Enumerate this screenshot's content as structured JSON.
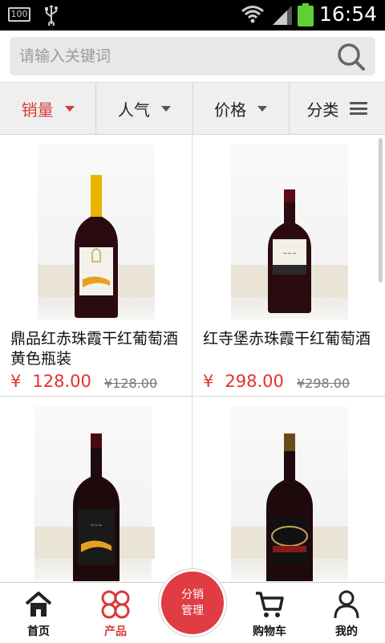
{
  "status_bar": {
    "battery_badge": "100",
    "time": "16:54"
  },
  "search": {
    "placeholder": "请输入关键词"
  },
  "filters": [
    {
      "label": "销量",
      "active": true
    },
    {
      "label": "人气",
      "active": false
    },
    {
      "label": "价格",
      "active": false
    },
    {
      "label": "分类",
      "active": false
    }
  ],
  "products": [
    {
      "name": "鼎品红赤珠霞干红葡萄酒黄色瓶装",
      "currency": "¥",
      "price": "128.00",
      "old_price": "¥128.00",
      "capsule_color": "#e8b400"
    },
    {
      "name": "红寺堡赤珠霞干红葡萄酒",
      "currency": "¥",
      "price": "298.00",
      "old_price": "¥298.00",
      "capsule_color": "#5a0c14"
    },
    {
      "name": "",
      "currency": "",
      "price": "",
      "old_price": "",
      "capsule_color": "#4a0a10"
    },
    {
      "name": "",
      "currency": "",
      "price": "",
      "old_price": "",
      "capsule_color": "#6b4a1a"
    }
  ],
  "tabbar": {
    "home": "首页",
    "products": "产品",
    "distribution": "分销管理",
    "cart": "购物车",
    "mine": "我的"
  },
  "colors": {
    "accent": "#d83a3a",
    "fab": "#e03c44"
  }
}
